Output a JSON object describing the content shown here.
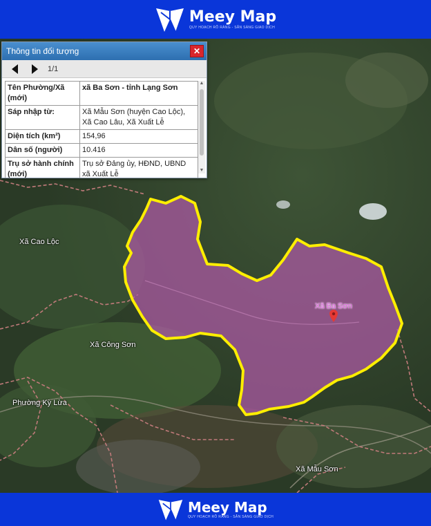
{
  "brand": {
    "name": "Meey Map",
    "tagline": "QUY HOẠCH RÕ RÀNG - SẴN SÀNG GIAO DỊCH"
  },
  "popup": {
    "title": "Thông tin đối tượng",
    "close_symbol": "✕",
    "pager": "1/1",
    "rows": [
      {
        "key": "Tên Phường/Xã (mới)",
        "value": "xã Ba Sơn - tỉnh Lạng Sơn"
      },
      {
        "key": "Sáp nhập từ:",
        "value": "Xã Mẫu Sơn (huyện Cao Lộc), Xã Cao Lâu, Xã Xuất Lễ"
      },
      {
        "key": "Diện tích (km²)",
        "value": "154,96"
      },
      {
        "key": "Dân số (người)",
        "value": "10.416"
      },
      {
        "key": "Trụ sở hành chính (mới)",
        "value": "Trụ sở Đảng ủy, HĐND, UBND xã Xuất Lễ"
      }
    ]
  },
  "map": {
    "labels": {
      "cao_loc": "Xã Cao Lộc",
      "ba_son": "Xã Ba Sơn",
      "cong_son": "Xã Công Sơn",
      "ky_lua": "Phường Kỳ Lừa",
      "mau_son": "Xã Mẫu Sơn"
    },
    "colors": {
      "highlight_fill": "#b05aa8",
      "highlight_stroke": "#ffee00",
      "admin_border": "#c07a7a",
      "brand_bar": "#0a36d9"
    }
  }
}
